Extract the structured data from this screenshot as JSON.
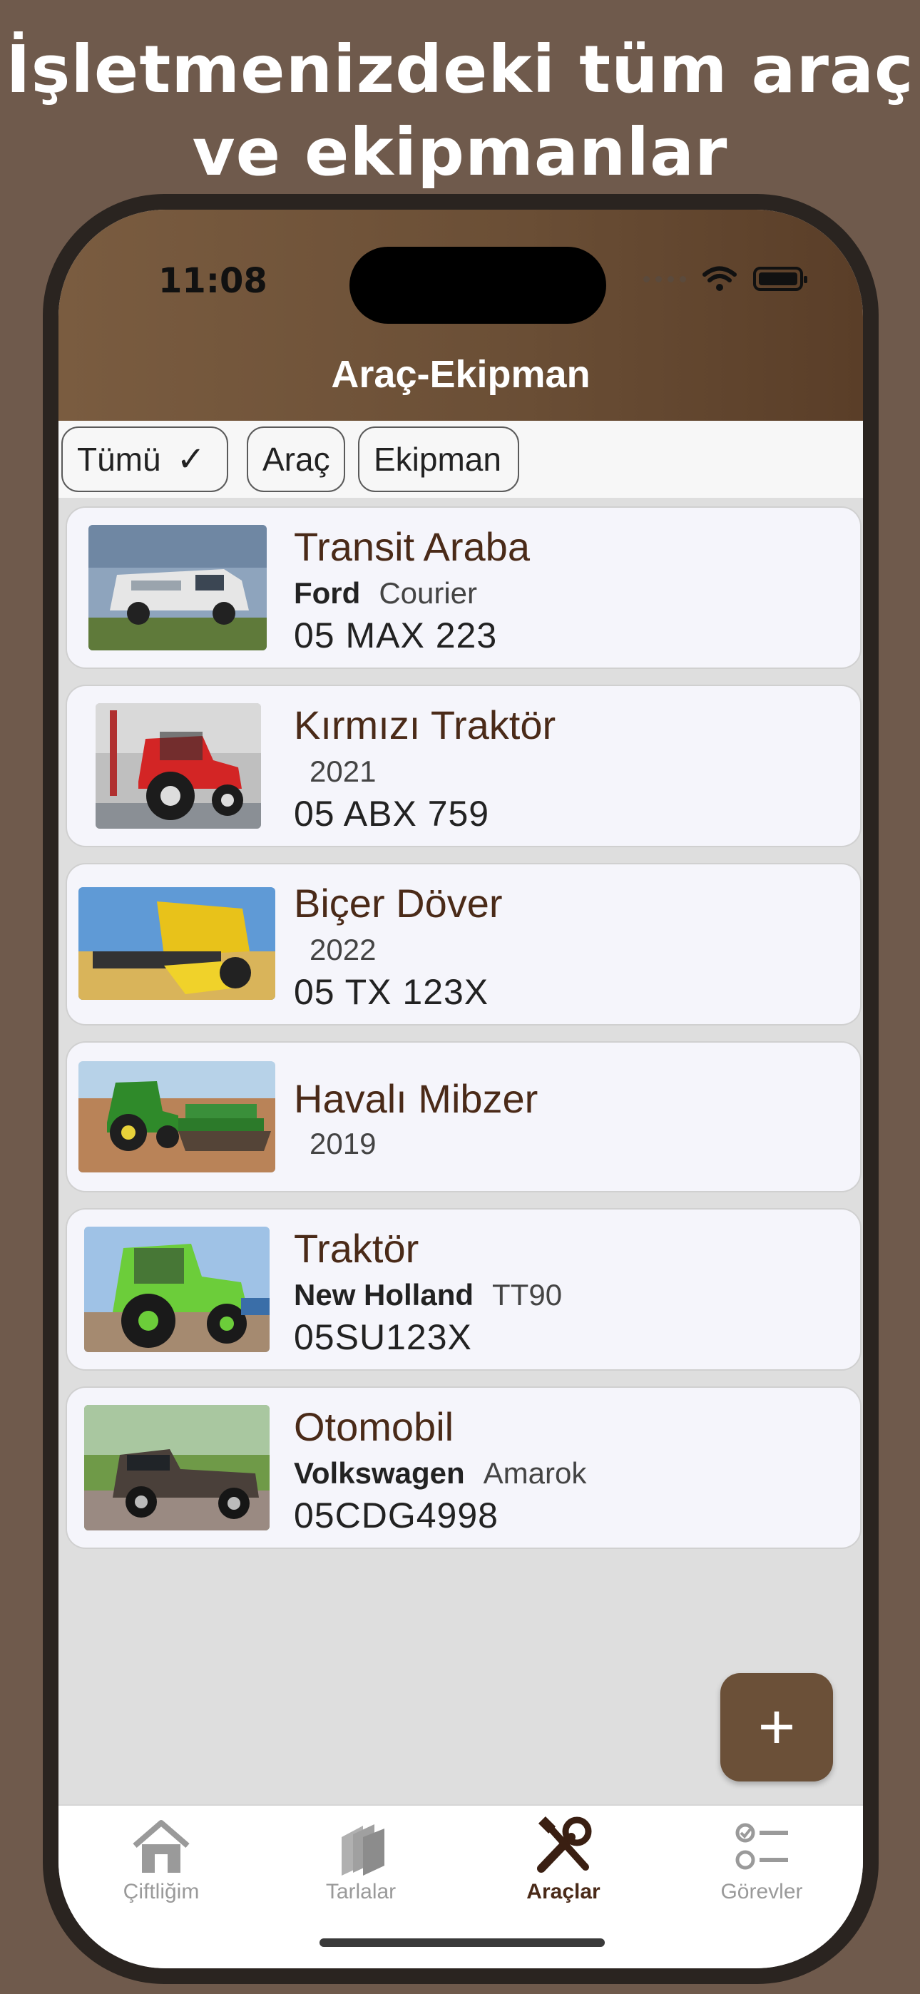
{
  "promo": {
    "line1": "İşletmenizdeki tüm araç",
    "line2": "ve ekipmanlar"
  },
  "status": {
    "time": "11:08"
  },
  "nav": {
    "title": "Araç-Ekipman"
  },
  "filters": [
    {
      "label": "Tümü",
      "checkmark": "✓",
      "selected": true
    },
    {
      "label": "Araç",
      "selected": false
    },
    {
      "label": "Ekipman",
      "selected": false
    }
  ],
  "items": [
    {
      "title": "Transit Araba",
      "brand": "Ford",
      "model": "Courier",
      "year": "",
      "plate": "05 MAX 223"
    },
    {
      "title": "Kırmızı Traktör",
      "brand": "",
      "model": "",
      "year": "2021",
      "plate": "05 ABX 759"
    },
    {
      "title": "Biçer Döver",
      "brand": "",
      "model": "",
      "year": "2022",
      "plate": "05 TX 123X"
    },
    {
      "title": "Havalı Mibzer",
      "brand": "",
      "model": "",
      "year": "2019",
      "plate": ""
    },
    {
      "title": "Traktör",
      "brand": "New Holland",
      "model": "TT90",
      "year": "",
      "plate": "05SU123X"
    },
    {
      "title": "Otomobil",
      "brand": "Volkswagen",
      "model": "Amarok",
      "year": "",
      "plate": "05CDG4998"
    }
  ],
  "fab": {
    "icon": "plus-icon",
    "symbol": "+"
  },
  "tabs": [
    {
      "label": "Çiftliğim",
      "icon": "home-icon",
      "active": false
    },
    {
      "label": "Tarlalar",
      "icon": "fields-icon",
      "active": false
    },
    {
      "label": "Araçlar",
      "icon": "tools-icon",
      "active": true
    },
    {
      "label": "Görevler",
      "icon": "checklist-icon",
      "active": false
    }
  ],
  "colors": {
    "brown": "#6b5038",
    "titleText": "#4a2a18",
    "background": "#6f5a4c"
  }
}
